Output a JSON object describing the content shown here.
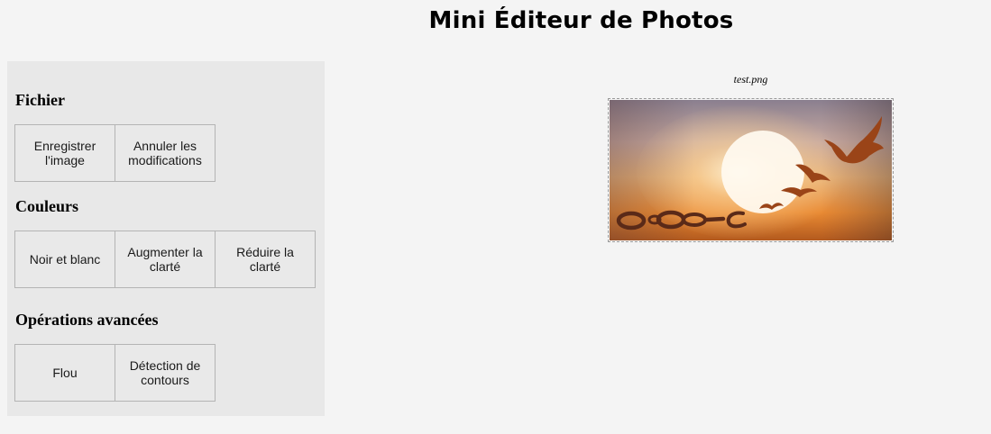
{
  "app": {
    "title": "Mini Éditeur de Photos"
  },
  "sidebar": {
    "sections": [
      {
        "heading": "Fichier",
        "buttons": [
          "Enregistrer l'image",
          "Annuler les modifications"
        ]
      },
      {
        "heading": "Couleurs",
        "buttons": [
          "Noir et blanc",
          "Augmenter la clarté",
          "Réduire la clarté"
        ]
      },
      {
        "heading": "Opérations avancées",
        "buttons": [
          "Flou",
          "Détection de contours"
        ]
      }
    ]
  },
  "workspace": {
    "file_name": "test.png",
    "image_subject": "sunset with breaking chain turning into birds"
  },
  "colors": {
    "page_bg": "#f4f4f4",
    "sidebar_bg": "#e8e8e8",
    "button_border": "#b4b4b4",
    "sunset_orange": "#e8922e",
    "chain_brown": "#5a2a18"
  }
}
